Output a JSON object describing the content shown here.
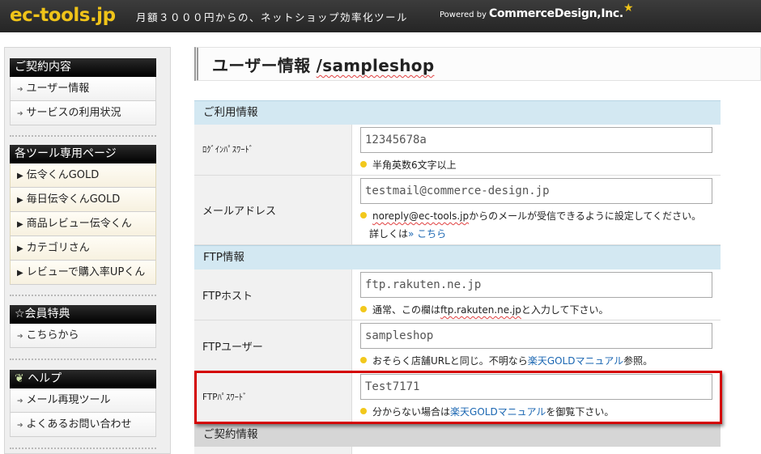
{
  "header": {
    "logo": "ec-tools.jp",
    "tagline": "月額３０００円からの、ネットショップ効率化ツール",
    "powered_by": "Powered by",
    "company": "CommerceDesign,Inc.",
    "star_icon": "star-icon"
  },
  "sidebar": {
    "contract": {
      "title": "ご契約内容",
      "items": [
        {
          "label": "ユーザー情報"
        },
        {
          "label": "サービスの利用状況"
        }
      ]
    },
    "tools": {
      "title": "各ツール専用ページ",
      "items": [
        {
          "label": "伝令くんGOLD"
        },
        {
          "label": "毎日伝令くんGOLD"
        },
        {
          "label": "商品レビュー伝令くん"
        },
        {
          "label": "カテゴリさん"
        },
        {
          "label": "レビューで購入率UPくん"
        }
      ]
    },
    "benefits": {
      "title": "☆会員特典",
      "items": [
        {
          "label": "こちらから"
        }
      ]
    },
    "help": {
      "title": "ヘルプ",
      "icon": "leaf-icon",
      "items": [
        {
          "label": "メール再現ツール"
        },
        {
          "label": "よくあるお問い合わせ"
        }
      ]
    }
  },
  "main": {
    "title": "ユーザー情報",
    "title_shop": "/sampleshop",
    "usage_section": "ご利用情報",
    "login": {
      "label": "ﾛｸﾞｲﾝﾊﾟｽﾜｰﾄﾞ",
      "value": "12345678a",
      "note": "半角英数6文字以上"
    },
    "email": {
      "label": "メールアドレス",
      "value": "testmail@commerce-design.jp",
      "note_addr": "noreply@ec-tools.jp",
      "note_rest": "からのメールが受信できるように設定してください。",
      "note2": "詳しくは",
      "note2_link": "» こちら"
    },
    "ftp_section": "FTP情報",
    "ftp_host": {
      "label": "FTPホスト",
      "value": "ftp.rakuten.ne.jp",
      "note_pre": "通常、この欄は",
      "note_host": "ftp.rakuten.ne.jp",
      "note_post": "と入力して下さい。"
    },
    "ftp_user": {
      "label": "FTPユーザー",
      "value": "sampleshop",
      "note_pre": "おそらく店舗URLと同じ。不明なら",
      "note_link": "楽天GOLDマニュアル",
      "note_post": "参照。"
    },
    "ftp_pass": {
      "label": "FTPﾊﾟｽﾜｰﾄﾞ",
      "value": "Test7171",
      "note_pre": "分からない場合は",
      "note_link": "楽天GOLDマニュアル",
      "note_post": "を御覧下さい。"
    },
    "contract_section": "ご契約情報"
  },
  "colors": {
    "accent_yellow": "#f2c81c",
    "section_blue": "#d3e8f2",
    "highlight_red": "#d40000",
    "link": "#1a66b2"
  }
}
